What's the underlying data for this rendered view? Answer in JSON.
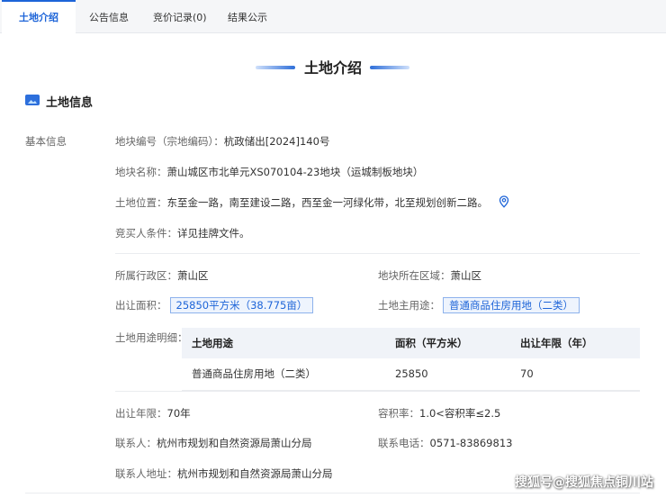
{
  "tabs": [
    {
      "label": "土地介绍",
      "active": true
    },
    {
      "label": "公告信息",
      "active": false
    },
    {
      "label": "竞价记录(0)",
      "active": false
    },
    {
      "label": "结果公示",
      "active": false
    }
  ],
  "section_title": "土地介绍",
  "sub_heading": "土地信息",
  "category_label": "基本信息",
  "basic": {
    "parcel_no_label": "地块编号（宗地编码）：",
    "parcel_no": "杭政储出[2024]140号",
    "parcel_name_label": "地块名称：",
    "parcel_name": "萧山城区市北单元XS070104-23地块（运城制板地块）",
    "location_label": "土地位置：",
    "location": "东至金一路，南至建设二路，西至金一河绿化带，北至规划创新二路。",
    "bidder_label": "竞买人条件：",
    "bidder": "详见挂牌文件。"
  },
  "details": {
    "district_label": "所属行政区：",
    "district": "萧山区",
    "region_label": "地块所在区域：",
    "region": "萧山区",
    "area_label": "出让面积：",
    "area": "25850平方米（38.775亩）",
    "main_use_label": "土地主用途：",
    "main_use": "普通商品住房用地（二类）",
    "use_detail_label": "土地用途明细：",
    "term_label": "出让年限：",
    "term": "70年",
    "far_label": "容积率：",
    "far": "1.0<容积率≤2.5",
    "contact_label": "联系人：",
    "contact": "杭州市规划和自然资源局萧山分局",
    "phone_label": "联系电话：",
    "phone": "0571-83869813",
    "address_label": "联系人地址：",
    "address": "杭州市规划和自然资源局萧山分局"
  },
  "use_table": {
    "headers": [
      "土地用途",
      "面积（平方米）",
      "出让年限（年）"
    ],
    "rows": [
      [
        "普通商品住房用地（二类）",
        "25850",
        "70"
      ]
    ]
  },
  "watermark": "搜狐号@搜狐焦点铜川站",
  "icons": {
    "section": "landscape-image-icon",
    "location": "map-pin-icon"
  },
  "colors": {
    "accent": "#1d64d8",
    "tag_bg": "#eef4fd",
    "tag_border": "#8db2ec",
    "table_head": "#f0f3f8"
  }
}
